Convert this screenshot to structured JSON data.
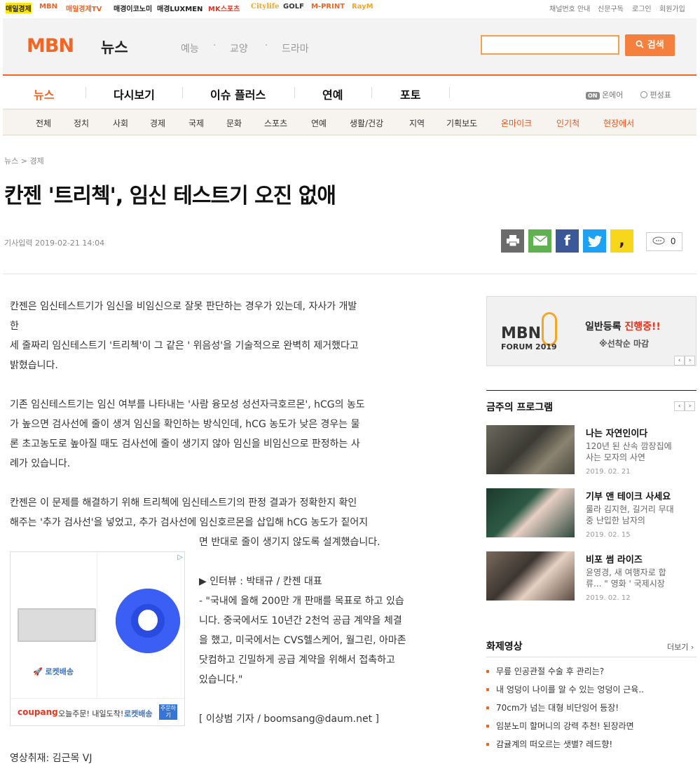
{
  "topbar": {
    "sites": [
      "매일경제",
      "MBN",
      "매일경제TV",
      "매경이코노미",
      "매경LUXMEN",
      "MK스포츠",
      "Citylife",
      "GOLF",
      "M-PRINT",
      "RayM"
    ],
    "util": [
      "채널번호 안내",
      "신문구독",
      "로그인",
      "회원가입"
    ]
  },
  "header": {
    "logo": "MBN",
    "section": "뉴스",
    "nav": [
      "예능",
      "교양",
      "드라마"
    ],
    "search_button": "검색",
    "search_placeholder": ""
  },
  "mainnav": {
    "items": [
      "뉴스",
      "다시보기",
      "이슈 플러스",
      "연예",
      "포토"
    ],
    "onair": "온에어",
    "schedule": "편성표"
  },
  "subnav": {
    "items": [
      "전체",
      "정치",
      "사회",
      "경제",
      "국제",
      "문화",
      "스포츠",
      "연예",
      "생활/건강",
      "지역",
      "기획보도",
      "온마이크",
      "인기척",
      "현장에서"
    ]
  },
  "article": {
    "breadcrumb": "뉴스 > 경제",
    "title": "칸젠 '트리첵', 임신 테스트기 오진 없애",
    "date": "기사입력 2019-02-21 14:04",
    "comment_count": "0",
    "lines": [
      "칸젠은 임신테스트기가 임신을 비임신으로 잘못 판단하는 경우가 있는데, 자사가 개발",
      "한",
      "세 줄짜리 임신테스트기 '트리첵'이 그 같은 ' 위음성'을 기술적으로 완벽히 제거했다고",
      "밝혔습니다.",
      "기존 임신테스트기는 임신 여부를 나타내는 '사람 융모성 성선자극호르몬', hCG의 농도",
      "가 높으면 검사선에 줄이 생겨 임신을 확인하는 방식인데, hCG 농도가 낮은 경우는 물",
      "론 초고농도로 높아질 때도 검사선에 줄이 생기지 않아 임신을 비임신으로 판정하는 사",
      "례가 있습니다.",
      "칸젠은 이 문제를 해결하기 위해 트리첵에 임신테스트기의 판정 결과가 정확한지 확인",
      "해주는 '추가 검사선'을 넣었고, 추가 검사선에 임신호르몬을 삽입해 hCG 농도가 짙어지"
    ],
    "narrow_lines": [
      "면 반대로 줄이 생기지 않도록 설계했습니다.",
      "▶  인터뷰 : 박태규 / 칸젠 대표",
      "- \"국내에 올해 200만 개 판매를 목표로 하고 있습",
      "니다. 중국에서도 10년간 2천억 공급 계약을 체결",
      "을 했고, 미국에서는 CVS헬스케어, 월그린, 아마존",
      "닷컴하고 긴밀하게 공급 계약을 위해서 접촉하고",
      "있습니다.\"",
      "[ 이상범 기자 / boomsang@daum.net ]"
    ],
    "credit": "영상취재: 김근목 VJ"
  },
  "ad": {
    "rocket": "로켓배송",
    "brand": "coupang",
    "tagline": "오늘주문! 내일도착!",
    "tagline2": "로켓배송",
    "badge": "주문하기"
  },
  "side_banner": {
    "logo": "MBN",
    "forum": "FORUM 2019",
    "text1": "일반등록",
    "text2": "진행중!!",
    "text3": "※선착순 마감"
  },
  "programs": {
    "title": "금주의 프로그램",
    "items": [
      {
        "title": "나는 자연인이다",
        "desc1": "120년 된 산속 깜장집에",
        "desc2": "사는 모자의 사연",
        "date": "2019. 02. 21"
      },
      {
        "title": "기부 앤 테이크 사세요",
        "desc1": "룰라 김지현, 길거리 무대",
        "desc2": "중 난입한 남자의",
        "date": "2019. 02. 15"
      },
      {
        "title": "비포 썸 라이즈",
        "desc1": "윤영경, 새 여행자로 합",
        "desc2": "류... \" 영화  ' 국제시장",
        "date": "2019. 02. 12"
      }
    ]
  },
  "videos": {
    "title": "화제영상",
    "more": "더보기 ›",
    "items": [
      "무릎 인공관절 수술 후 관리는?",
      "내 엉덩이 나이를 알 수 있는 엉덩이 근육..",
      "70cm가 넘는 대형 비단잉어 등장!",
      "임분노미 할머니의 강력 추천! 된장라면",
      "감귤계의 떠오르는 샛별? 레드향!"
    ]
  },
  "colors": {
    "accent": "#f26522",
    "link_hl": "#e8541c"
  }
}
